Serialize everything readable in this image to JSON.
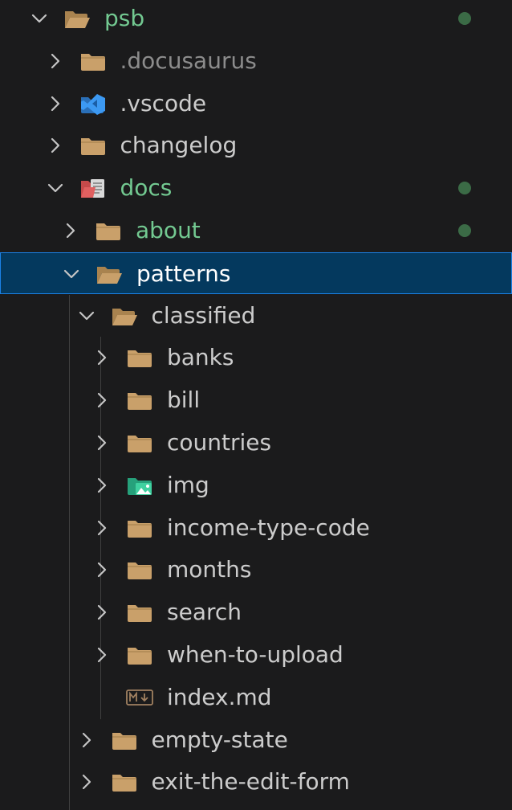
{
  "colors": {
    "background": "#1b1b1c",
    "selected_bg": "#04395e",
    "selected_border": "#1b81e6",
    "git_modified_text": "#73c991",
    "git_dot": "#3b6b46",
    "ignored_text": "#8c8c8c",
    "default_text": "#cccccc",
    "folder_icon": "#c9a06a"
  },
  "tree": [
    {
      "label": "psb",
      "depth": 0,
      "expanded": true,
      "icon": "folder-open-icon",
      "status": "modified",
      "dot": true
    },
    {
      "label": ".docusaurus",
      "depth": 1,
      "expanded": false,
      "icon": "folder-icon",
      "status": "ignored"
    },
    {
      "label": ".vscode",
      "depth": 1,
      "expanded": false,
      "icon": "vscode-folder-icon",
      "status": "normal"
    },
    {
      "label": "changelog",
      "depth": 1,
      "expanded": false,
      "icon": "folder-icon",
      "status": "normal"
    },
    {
      "label": "docs",
      "depth": 1,
      "expanded": true,
      "icon": "docs-folder-open-icon",
      "status": "modified",
      "dot": true
    },
    {
      "label": "about",
      "depth": 2,
      "expanded": false,
      "icon": "folder-icon",
      "status": "modified",
      "dot": true
    },
    {
      "label": "patterns",
      "depth": 2,
      "expanded": true,
      "icon": "folder-open-icon",
      "status": "selected",
      "selected": true
    },
    {
      "label": "classified",
      "depth": 3,
      "expanded": true,
      "icon": "folder-open-icon",
      "status": "normal"
    },
    {
      "label": "banks",
      "depth": 4,
      "expanded": false,
      "icon": "folder-icon",
      "status": "normal"
    },
    {
      "label": "bill",
      "depth": 4,
      "expanded": false,
      "icon": "folder-icon",
      "status": "normal"
    },
    {
      "label": "countries",
      "depth": 4,
      "expanded": false,
      "icon": "folder-icon",
      "status": "normal"
    },
    {
      "label": "img",
      "depth": 4,
      "expanded": false,
      "icon": "image-folder-icon",
      "status": "normal"
    },
    {
      "label": "income-type-code",
      "depth": 4,
      "expanded": false,
      "icon": "folder-icon",
      "status": "normal"
    },
    {
      "label": "months",
      "depth": 4,
      "expanded": false,
      "icon": "folder-icon",
      "status": "normal"
    },
    {
      "label": "search",
      "depth": 4,
      "expanded": false,
      "icon": "folder-icon",
      "status": "normal"
    },
    {
      "label": "when-to-upload",
      "depth": 4,
      "expanded": false,
      "icon": "folder-icon",
      "status": "normal"
    },
    {
      "label": "index.md",
      "depth": 4,
      "file": true,
      "icon": "markdown-file-icon",
      "status": "normal"
    },
    {
      "label": "empty-state",
      "depth": 3,
      "expanded": false,
      "icon": "folder-icon",
      "status": "normal"
    },
    {
      "label": "exit-the-edit-form",
      "depth": 3,
      "expanded": false,
      "icon": "folder-icon",
      "status": "normal"
    }
  ]
}
